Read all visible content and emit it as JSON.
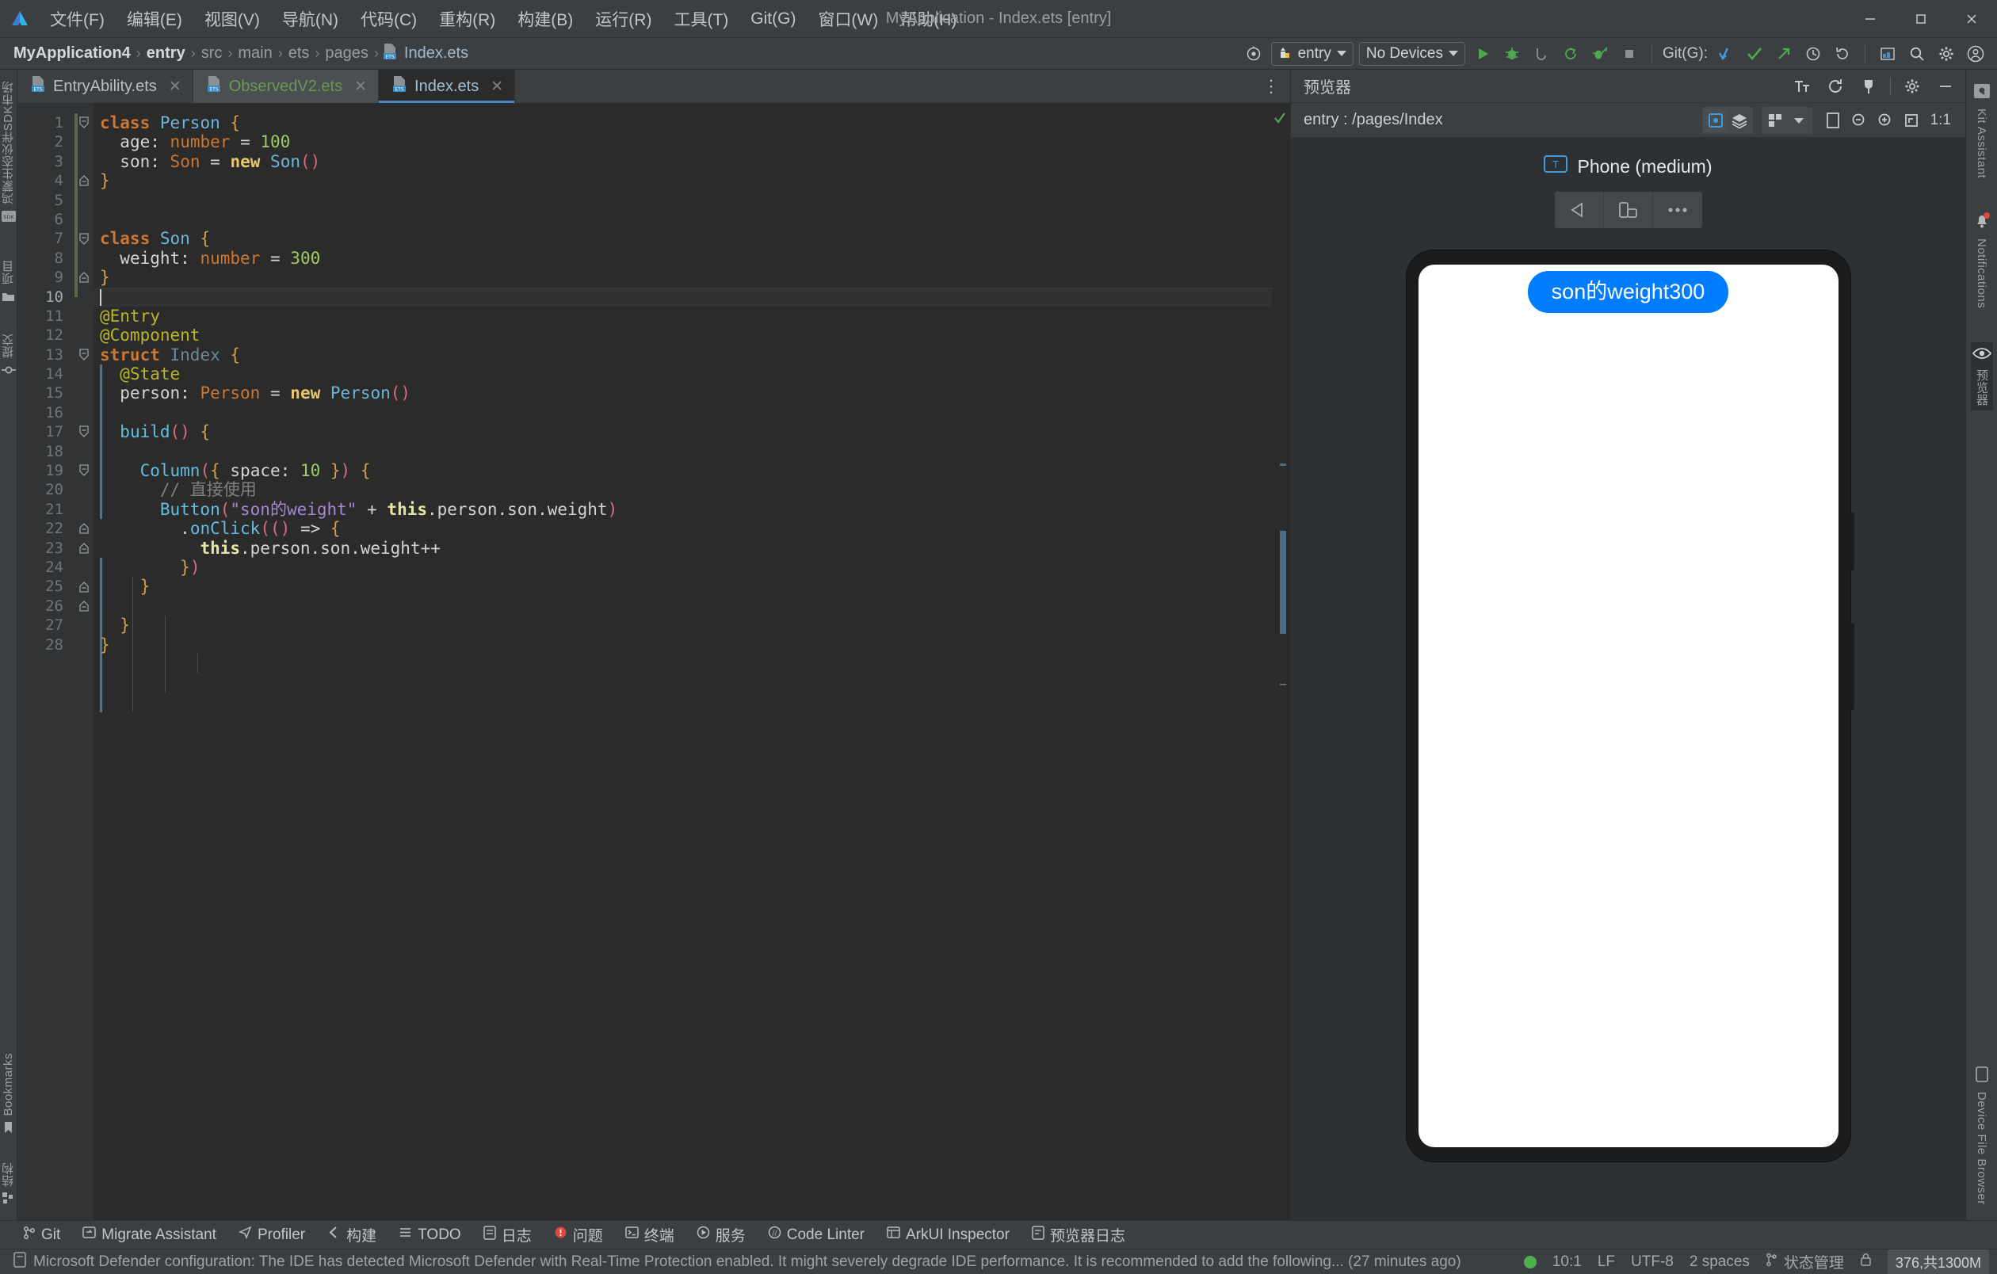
{
  "window": {
    "title": "MyApplication - Index.ets [entry]",
    "minimize": "—",
    "maximize": "▢",
    "close": "✕"
  },
  "menu": [
    {
      "label": "文件(F)"
    },
    {
      "label": "编辑(E)"
    },
    {
      "label": "视图(V)"
    },
    {
      "label": "导航(N)"
    },
    {
      "label": "代码(C)"
    },
    {
      "label": "重构(R)"
    },
    {
      "label": "构建(B)"
    },
    {
      "label": "运行(R)"
    },
    {
      "label": "工具(T)"
    },
    {
      "label": "Git(G)"
    },
    {
      "label": "窗口(W)"
    },
    {
      "label": "帮助(H)"
    }
  ],
  "breadcrumb": {
    "items": [
      "MyApplication4",
      "entry",
      "src",
      "main",
      "ets",
      "pages",
      "Index.ets"
    ],
    "separator": "›"
  },
  "toolbar": {
    "device_target": "entry",
    "devices": "No Devices",
    "git_label": "Git(G):"
  },
  "tabs": [
    {
      "label": "EntryAbility.ets",
      "close": "✕",
      "active": false
    },
    {
      "label": "ObservedV2.ets",
      "close": "✕",
      "active": false
    },
    {
      "label": "Index.ets",
      "close": "✕",
      "active": true
    }
  ],
  "editor": {
    "line_count": 28,
    "lines": [
      {
        "n": 1,
        "text": "class Person {"
      },
      {
        "n": 2,
        "text": "  age: number = 100"
      },
      {
        "n": 3,
        "text": "  son: Son = new Son()"
      },
      {
        "n": 4,
        "text": "}"
      },
      {
        "n": 5,
        "text": ""
      },
      {
        "n": 6,
        "text": ""
      },
      {
        "n": 7,
        "text": "class Son {"
      },
      {
        "n": 8,
        "text": "  weight: number = 300"
      },
      {
        "n": 9,
        "text": "}"
      },
      {
        "n": 10,
        "text": ""
      },
      {
        "n": 11,
        "text": "@Entry"
      },
      {
        "n": 12,
        "text": "@Component"
      },
      {
        "n": 13,
        "text": "struct Index {"
      },
      {
        "n": 14,
        "text": "  @State"
      },
      {
        "n": 15,
        "text": "  person: Person = new Person()"
      },
      {
        "n": 16,
        "text": ""
      },
      {
        "n": 17,
        "text": "  build() {"
      },
      {
        "n": 18,
        "text": ""
      },
      {
        "n": 19,
        "text": "    Column({ space: 10 }) {"
      },
      {
        "n": 20,
        "text": "      // 直接使用"
      },
      {
        "n": 21,
        "text": "      Button(\"son的weight\" + this.person.son.weight)"
      },
      {
        "n": 22,
        "text": "        .onClick(() => {"
      },
      {
        "n": 23,
        "text": "          this.person.son.weight++"
      },
      {
        "n": 24,
        "text": "        })"
      },
      {
        "n": 25,
        "text": "    }"
      },
      {
        "n": 26,
        "text": ""
      },
      {
        "n": 27,
        "text": "  }"
      },
      {
        "n": 28,
        "text": "}"
      }
    ],
    "current_line": 10
  },
  "left_strip": {
    "items": [
      {
        "label": "鸿蒙生态伙伴SDK市场",
        "icon": "sdk-icon"
      },
      {
        "label": "项目",
        "icon": "folder-icon"
      },
      {
        "label": "提交",
        "icon": "commit-icon"
      },
      {
        "label": "Bookmarks",
        "icon": "bookmark-icon"
      },
      {
        "label": "结构",
        "icon": "structure-icon"
      }
    ]
  },
  "right_strip": {
    "items": [
      {
        "label": "Kit Assistant",
        "icon": "kit-icon"
      },
      {
        "label": "Notifications",
        "icon": "bell-icon"
      },
      {
        "label": "预览器",
        "icon": "eye-icon"
      }
    ]
  },
  "previewer": {
    "title": "预览器",
    "route": "entry : /pages/Index",
    "device_name": "Phone (medium)",
    "zoom_ratio": "1:1",
    "button_text": "son的weight300"
  },
  "tool_windows": [
    {
      "label": "Git",
      "icon": "git-icon"
    },
    {
      "label": "Migrate Assistant",
      "icon": "migrate-icon"
    },
    {
      "label": "Profiler",
      "icon": "profiler-icon"
    },
    {
      "label": "构建",
      "icon": "build-icon"
    },
    {
      "label": "TODO",
      "icon": "todo-icon"
    },
    {
      "label": "日志",
      "icon": "log-icon"
    },
    {
      "label": "问题",
      "icon": "problems-icon"
    },
    {
      "label": "终端",
      "icon": "terminal-icon"
    },
    {
      "label": "服务",
      "icon": "services-icon"
    },
    {
      "label": "Code Linter",
      "icon": "linter-icon"
    },
    {
      "label": "ArkUI Inspector",
      "icon": "inspector-icon"
    },
    {
      "label": "预览器日志",
      "icon": "previewer-log-icon"
    }
  ],
  "status": {
    "message": "Microsoft Defender configuration: The IDE has detected Microsoft Defender with Real-Time Protection enabled. It might severely degrade IDE performance. It is recommended to add the following... (27 minutes ago)",
    "caret": "10:1",
    "line_sep": "LF",
    "encoding": "UTF-8",
    "indent": "2 spaces",
    "branch": "状态管理",
    "memory": "376,共1300M"
  },
  "colors": {
    "accent": "#007dff",
    "ok": "#4caf50",
    "chrome": "#3c3f41",
    "editor_bg": "#2b2b2b"
  }
}
